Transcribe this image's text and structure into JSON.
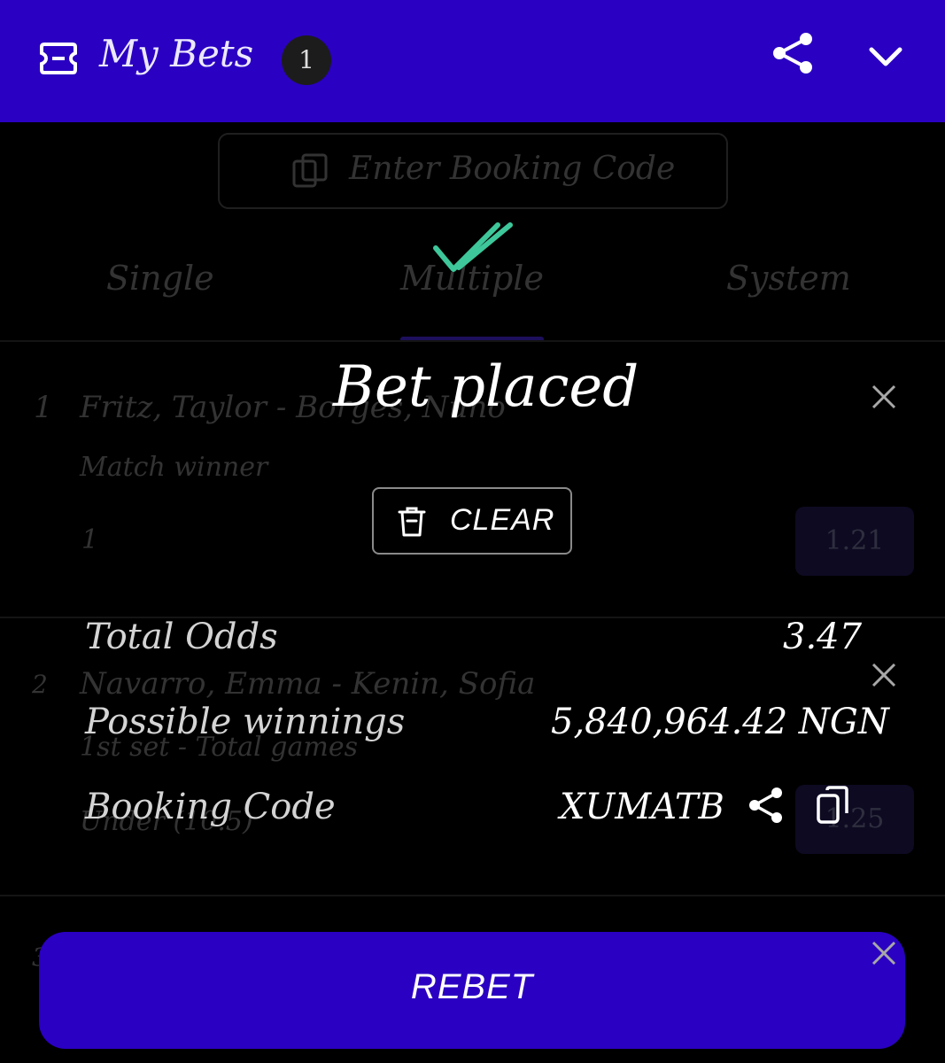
{
  "header": {
    "title": "My Bets",
    "badge_count": "1",
    "background": "#2a00c2"
  },
  "background_layer": {
    "booking_placeholder": "Enter Booking Code",
    "tabs": [
      {
        "label": "Single"
      },
      {
        "label": "Multiple"
      },
      {
        "label": "System"
      }
    ],
    "selections": [
      {
        "index": "1",
        "event": "Fritz, Taylor - Borges, Nuno",
        "market": "Match winner",
        "pick": "1",
        "odds": "1.21"
      },
      {
        "index": "2",
        "event": "Navarro, Emma - Kenin, Sofia",
        "market": "1st set - Total games",
        "pick": "Under (10.5)",
        "odds": "1.25"
      },
      {
        "index": "3"
      }
    ]
  },
  "modal": {
    "title": "Bet placed",
    "success_color": "#3ec79a",
    "clear_label": "CLEAR",
    "summary": {
      "total_odds_label": "Total Odds",
      "total_odds_value": "3.47",
      "winnings_label": "Possible winnings",
      "winnings_value": "5,840,964.42 NGN",
      "booking_label": "Booking Code",
      "booking_value": "XUMATB"
    },
    "rebet_label": "REBET"
  },
  "icons": [
    "ticket-icon",
    "share-icon",
    "chevron-down-icon",
    "booking-code-icon",
    "double-check-icon",
    "trash-icon",
    "close-icon",
    "copy-icon"
  ]
}
